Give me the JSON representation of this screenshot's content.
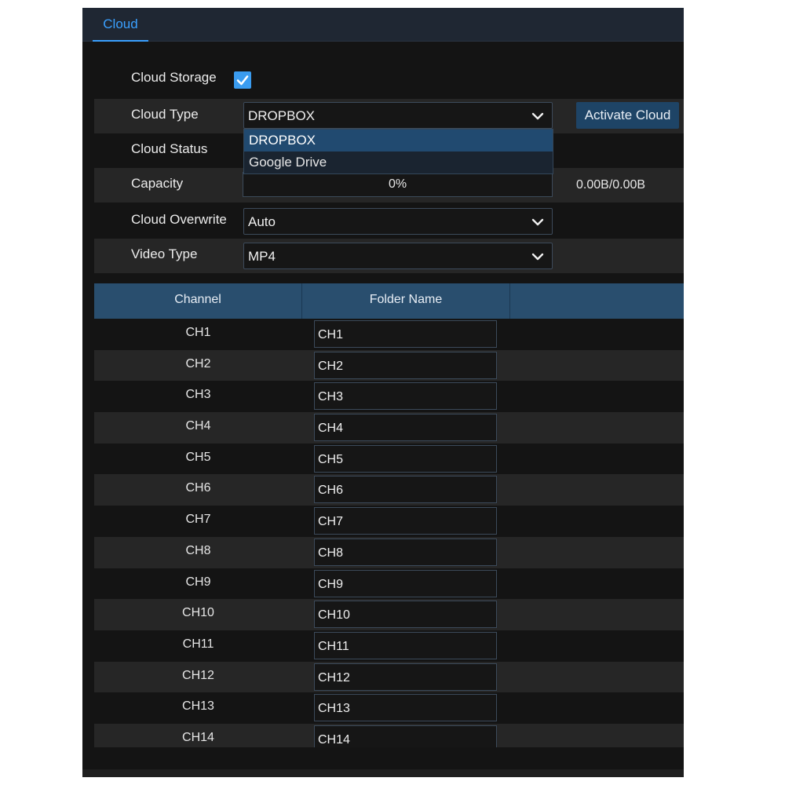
{
  "tabs": [
    {
      "label": "Cloud",
      "active": true
    }
  ],
  "form": {
    "cloud_storage_label": "Cloud Storage",
    "cloud_storage_checked": true,
    "cloud_type_label": "Cloud Type",
    "cloud_type_value": "DROPBOX",
    "cloud_type_options": [
      "DROPBOX",
      "Google Drive"
    ],
    "activate_button": "Activate Cloud",
    "cloud_status_label": "Cloud Status",
    "capacity_label": "Capacity",
    "capacity_percent": "0%",
    "capacity_fraction": 0,
    "capacity_value": "0.00B/0.00B",
    "cloud_overwrite_label": "Cloud Overwrite",
    "cloud_overwrite_value": "Auto",
    "video_type_label": "Video Type",
    "video_type_value": "MP4"
  },
  "table": {
    "headers": [
      "Channel",
      "Folder Name",
      ""
    ],
    "rows": [
      {
        "channel": "CH1",
        "folder": "CH1"
      },
      {
        "channel": "CH2",
        "folder": "CH2"
      },
      {
        "channel": "CH3",
        "folder": "CH3"
      },
      {
        "channel": "CH4",
        "folder": "CH4"
      },
      {
        "channel": "CH5",
        "folder": "CH5"
      },
      {
        "channel": "CH6",
        "folder": "CH6"
      },
      {
        "channel": "CH7",
        "folder": "CH7"
      },
      {
        "channel": "CH8",
        "folder": "CH8"
      },
      {
        "channel": "CH9",
        "folder": "CH9"
      },
      {
        "channel": "CH10",
        "folder": "CH10"
      },
      {
        "channel": "CH11",
        "folder": "CH11"
      },
      {
        "channel": "CH12",
        "folder": "CH12"
      },
      {
        "channel": "CH13",
        "folder": "CH13"
      },
      {
        "channel": "CH14",
        "folder": "CH14"
      }
    ]
  },
  "colors": {
    "accent": "#3aa0ff",
    "header": "#294e6e",
    "button": "#1e4466",
    "background": "#141414",
    "row_shade": "#262626"
  },
  "icons": {
    "checkbox": "checkmark-icon",
    "select": "chevron-down-icon"
  }
}
